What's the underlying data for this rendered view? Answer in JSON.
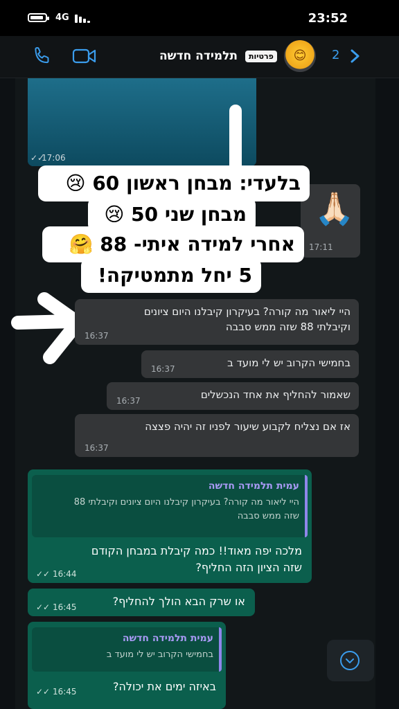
{
  "status_bar": {
    "time": "23:52",
    "network": "4G"
  },
  "header": {
    "title": "תלמידה חדשה",
    "badge": "פרטיות",
    "back_count": "2",
    "avatar_emoji": "😊"
  },
  "media_message": {
    "time": "17:06"
  },
  "captions": [
    "בלעדי: מבחן ראשון 60 😢",
    "מבחן שני 50 😢",
    "אחרי למידה איתי- 88 🤗",
    "5 יחל מתמטיקה!"
  ],
  "pray_message": {
    "emoji": "🙏🏻",
    "time": "17:11"
  },
  "incoming": [
    {
      "lines": [
        "היי ליאור מה קורה? בעיקרון קיבלנו היום ציונים",
        "וקיבלתי 88 שזה ממש סבבה"
      ],
      "time": "16:37"
    },
    {
      "lines": [
        "בחמישי הקרוב יש לי מועד ב"
      ],
      "time": "16:37"
    },
    {
      "lines": [
        "שאמור להחליף את אחד הנכשלים"
      ],
      "time": "16:37"
    },
    {
      "lines": [
        "אז אם נצליח לקבוע שיעור לפניו זה יהיה פצצה"
      ],
      "time": "16:37"
    }
  ],
  "outgoing": [
    {
      "quote_name": "עמית תלמידה חדשה",
      "quote_lines": [
        "היי ליאור מה קורה? בעיקרון קיבלנו היום ציונים וקיבלתי 88",
        "שזה ממש סבבה"
      ],
      "lines": [
        "מלכה יפה מאוד!! כמה קיבלת במבחן הקודם",
        "שזה הציון הזה החליף?"
      ],
      "time": "16:44"
    },
    {
      "lines": [
        "או שרק הבא הולך להחליף?"
      ],
      "time": "16:45"
    },
    {
      "quote_name": "עמית תלמידה חדשה",
      "quote_lines": [
        "בחמישי הקרוב יש לי מועד ב"
      ],
      "lines": [
        "באיזה ימים את יכולה?"
      ],
      "time": "16:45"
    }
  ],
  "colors": {
    "accent": "#3b9ded",
    "incoming_bubble": "#343638",
    "outgoing_bubble": "#0b5f4d",
    "quote_name": "#a99af5"
  }
}
